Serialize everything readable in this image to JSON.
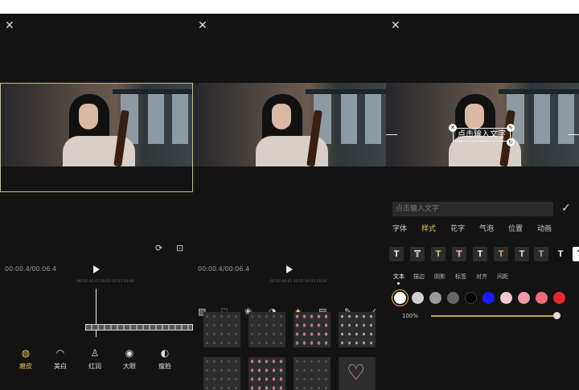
{
  "panels": {
    "edit": {
      "time": "00:00.4/00:06.4",
      "ruler": "00:00          00:01          00:02          00:03          00:04",
      "tools": [
        {
          "label": "磨皮",
          "icon": "smooth-icon",
          "glyph": "◍"
        },
        {
          "label": "美白",
          "icon": "whiten-icon",
          "glyph": "◠"
        },
        {
          "label": "红润",
          "icon": "rosy-icon",
          "glyph": "♙"
        },
        {
          "label": "大眼",
          "icon": "eye-icon",
          "glyph": "◉"
        },
        {
          "label": "瘦脸",
          "icon": "face-icon",
          "glyph": "◐"
        }
      ]
    },
    "effects": {
      "time": "00:00.4/00:06.4",
      "ruler": "00:00          00:01          00:02          00:03          00:04",
      "icons": [
        "image-percent-icon",
        "heart-icon",
        "sticker-icon",
        "mask-icon",
        "sparkle-icon",
        "label-icon",
        "pen-icon",
        "check-icon"
      ],
      "glyphs": [
        "▨",
        "♡",
        "❀",
        "◕",
        "✦",
        "▤",
        "✎",
        "✓"
      ]
    },
    "text": {
      "overlay_text": "点击输入文字",
      "input_placeholder": "点击输入文字",
      "tabs": [
        "字体",
        "样式",
        "花字",
        "气泡",
        "位置",
        "动画"
      ],
      "sub_tabs": [
        "文本",
        "描边",
        "阴影",
        "标签",
        "对齐",
        "间距"
      ],
      "opacity": "100%",
      "swatches": [
        "#ffffff",
        "#d0d0d0",
        "#9b9b9b",
        "#666666",
        "#000000",
        "#1a1aff",
        "#f5c6cf",
        "#f09aa6",
        "#ee6d7a",
        "#e8282b"
      ]
    }
  },
  "colors": {
    "accent": "#e6c25a",
    "bg": "#131313"
  }
}
